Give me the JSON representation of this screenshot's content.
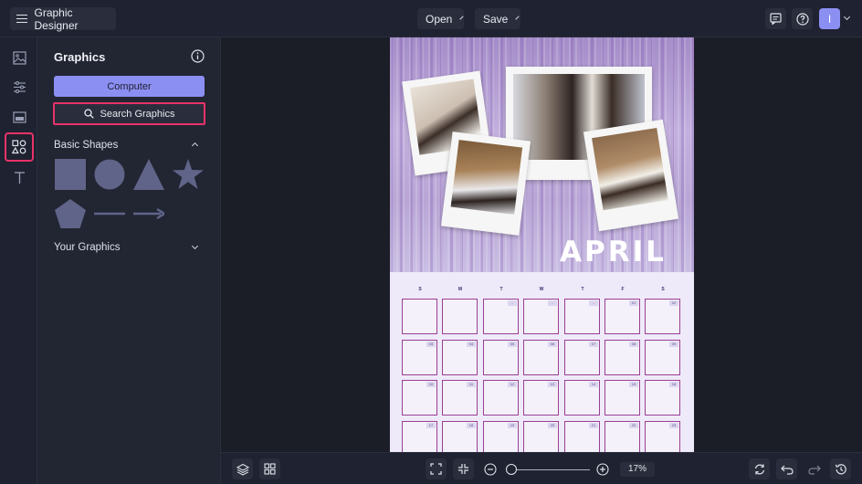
{
  "topbar": {
    "app_title": "Graphic Designer",
    "open_label": "Open",
    "save_label": "Save",
    "avatar_initial": "I"
  },
  "panel": {
    "title": "Graphics",
    "computer_button": "Computer",
    "search_button": "Search Graphics",
    "basic_shapes_label": "Basic Shapes",
    "your_graphics_label": "Your Graphics"
  },
  "poster": {
    "month": "APRIL",
    "weekdays": [
      "S",
      "M",
      "T",
      "W",
      "T",
      "F",
      "S"
    ],
    "rows": [
      [
        "",
        "",
        "-",
        "-",
        "-",
        "01",
        "02"
      ],
      [
        "03",
        "04",
        "05",
        "06",
        "07",
        "08",
        "09"
      ],
      [
        "10",
        "11",
        "12",
        "13",
        "14",
        "15",
        "16"
      ],
      [
        "17",
        "18",
        "19",
        "20",
        "21",
        "22",
        "23"
      ]
    ]
  },
  "bottombar": {
    "zoom": "17%"
  },
  "colors": {
    "accent": "#8c8ff2",
    "highlight": "#e8326b",
    "shape_fill": "#5f6488"
  }
}
